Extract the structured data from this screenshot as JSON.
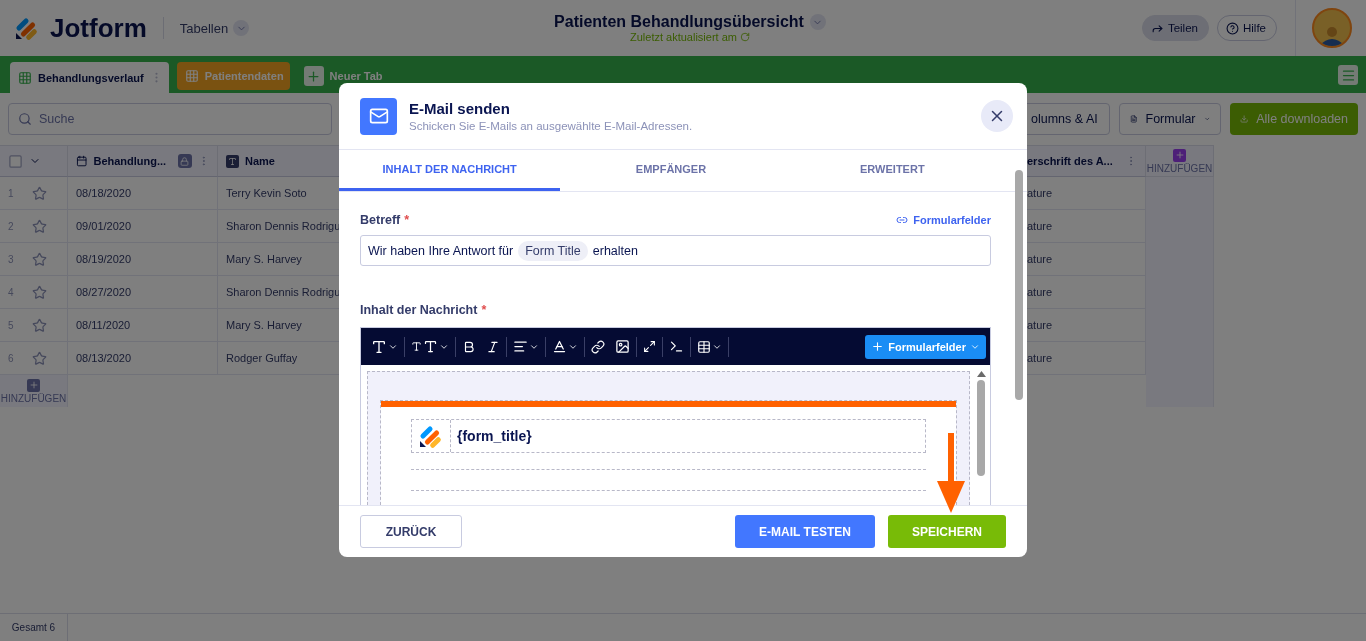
{
  "app": {
    "logo": "Jotform",
    "section": "Tabellen"
  },
  "document": {
    "title": "Patienten Behandlungsübersicht",
    "status": "Zuletzt aktualisiert am"
  },
  "header_actions": [
    {
      "label": "Teilen",
      "kind": "share"
    },
    {
      "label": "Hilfe",
      "kind": "help"
    }
  ],
  "tabs": [
    {
      "label": "Behandlungsverlauf",
      "selected": true
    },
    {
      "label": "Patientendaten",
      "selected": false
    }
  ],
  "new_tab": "Neuer Tab",
  "search": {
    "placeholder": "Suche"
  },
  "toolbar_buttons": [
    {
      "label": "olumns & AI",
      "kind": "dropdown"
    },
    {
      "label": "Formular",
      "kind": "form"
    },
    {
      "label": "Alle downloaden",
      "kind": "download"
    }
  ],
  "table": {
    "select_all": {
      "checked": false
    },
    "columns": [
      {
        "label": "Behandlung...",
        "kind": "date"
      },
      {
        "label": "Name",
        "kind": "text"
      },
      {
        "label": "erschrift des A...",
        "kind": "signature"
      }
    ],
    "add_column": "HINZUFÜGEN",
    "rows": [
      {
        "number": "1",
        "starred": false,
        "cells": [
          "08/18/2020",
          "Terry Kevin Soto",
          "ature"
        ]
      },
      {
        "number": "2",
        "starred": false,
        "cells": [
          "09/01/2020",
          "Sharon Dennis Rodrigu",
          "ature"
        ]
      },
      {
        "number": "3",
        "starred": false,
        "cells": [
          "08/19/2020",
          "Mary S. Harvey",
          "ature"
        ]
      },
      {
        "number": "4",
        "starred": false,
        "cells": [
          "08/27/2020",
          "Sharon Dennis Rodrigu",
          "ature"
        ]
      },
      {
        "number": "5",
        "starred": false,
        "cells": [
          "08/11/2020",
          "Mary S. Harvey",
          "ature"
        ]
      },
      {
        "number": "6",
        "starred": false,
        "cells": [
          "08/13/2020",
          "Rodger Guffay",
          "ature"
        ]
      }
    ],
    "add_row": "HINZUFÜGEN"
  },
  "status_bar": {
    "total": "Gesamt 6"
  },
  "dialog": {
    "title": "E-Mail senden",
    "subtitle": "Schicken Sie E-Mails an ausgewählte E-Mail-Adressen.",
    "tabs": [
      {
        "label": "INHALT DER NACHRICHT",
        "selected": true
      },
      {
        "label": "EMPFÄNGER",
        "selected": false
      },
      {
        "label": "ERWEITERT",
        "selected": false
      }
    ],
    "subject": {
      "label": "Betreff",
      "required": "*",
      "link": "Formularfelder",
      "value_before": "Wir haben Ihre Antwort für",
      "chip": "Form Title",
      "value_after": "erhalten"
    },
    "body": {
      "label": "Inhalt der Nachricht",
      "required": "*",
      "insert_button": "Formularfelder",
      "template_title": "{form_title}"
    },
    "buttons": [
      {
        "label": "ZURÜCK",
        "kind": "back"
      },
      {
        "label": "E-MAIL TESTEN",
        "kind": "test"
      },
      {
        "label": "SPEICHERN",
        "kind": "save"
      }
    ]
  }
}
